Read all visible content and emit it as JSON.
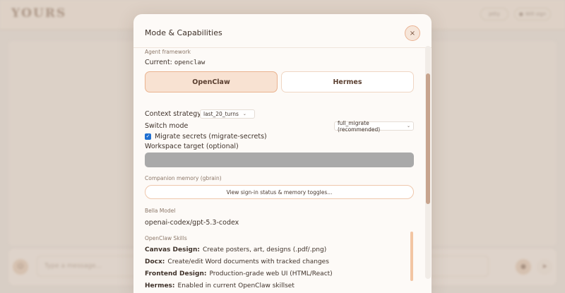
{
  "background": {
    "logo": "YOURS",
    "header_btn_1": "jetty",
    "header_btn_2": "Will sign",
    "composer_placeholder": "Type a message..."
  },
  "modal": {
    "title": "Mode & Capabilities",
    "close_label": "×",
    "agent_framework": {
      "section_label": "Agent framework",
      "current_prefix": "Current:",
      "current_value": "openclaw",
      "options": [
        "OpenClaw",
        "Hermes"
      ],
      "selected": "OpenClaw"
    },
    "context_strategy": {
      "label": "Context strategy",
      "value": "last_20_turns"
    },
    "switch_mode": {
      "label": "Switch mode",
      "value": "full_migrate (recommended)"
    },
    "migrate_secrets": {
      "label": "Migrate secrets (migrate-secrets)",
      "checked": true
    },
    "workspace_target": {
      "label": "Workspace target (optional)",
      "value": ""
    },
    "companion_memory": {
      "section_label": "Companion memory (gbrain)",
      "button_label": "View sign-in status & memory toggles..."
    },
    "bella_model": {
      "section_label": "Bella Model",
      "value": "openai-codex/gpt-5.3-codex"
    },
    "skills": {
      "section_label": "OpenClaw Skills",
      "items": [
        {
          "name": "Canvas Design:",
          "desc": "Create posters, art, designs (.pdf/.png)"
        },
        {
          "name": "Docx:",
          "desc": "Create/edit Word documents with tracked changes"
        },
        {
          "name": "Frontend Design:",
          "desc": "Production-grade web UI (HTML/React)"
        },
        {
          "name": "Hermes:",
          "desc": "Enabled in current OpenClaw skillset"
        }
      ]
    }
  },
  "colors": {
    "accent": "#eab38f",
    "active_bg": "#f8e2d2",
    "checkbox": "#1f6fd1",
    "scroll_thumb": "#c7a48e"
  }
}
